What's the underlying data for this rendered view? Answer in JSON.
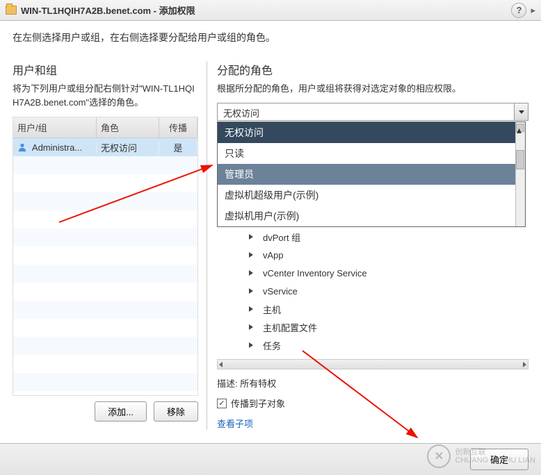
{
  "title": "WIN-TL1HQIH7A2B.benet.com - 添加权限",
  "instruction": "在左侧选择用户或组，在右侧选择要分配给用户或组的角色。",
  "left": {
    "heading": "用户和组",
    "desc": "将为下列用户或组分配右侧针对\"WIN-TL1HQIH7A2B.benet.com\"选择的角色。",
    "cols": {
      "user": "用户/组",
      "role": "角色",
      "prop": "传播"
    },
    "rows": [
      {
        "user": "Administra...",
        "role": "无权访问",
        "prop": "是"
      }
    ],
    "btn_add": "添加...",
    "btn_remove": "移除"
  },
  "right": {
    "heading": "分配的角色",
    "desc": "根据所分配的角色，用户或组将获得对选定对象的相应权限。",
    "combo_value": "无权访问",
    "dropdown": [
      {
        "label": "无权访问",
        "cls": "dark"
      },
      {
        "label": "只读",
        "cls": ""
      },
      {
        "label": "管理员",
        "cls": "hilite"
      },
      {
        "label": "虚拟机超级用户(示例)",
        "cls": ""
      },
      {
        "label": "虚拟机用户(示例)",
        "cls": ""
      }
    ],
    "tree": [
      "dvPort 组",
      "vApp",
      "vCenter Inventory Service",
      "vService",
      "主机",
      "主机配置文件",
      "任务"
    ],
    "desc_label": "描述:",
    "desc_value": "所有特权",
    "propagate_label": "传播到子对象",
    "view_children": "查看子项"
  },
  "footer": {
    "ok": "确定"
  },
  "watermark": {
    "brand": "创新互联",
    "url": "CHUANG XIN HU LIAN"
  }
}
